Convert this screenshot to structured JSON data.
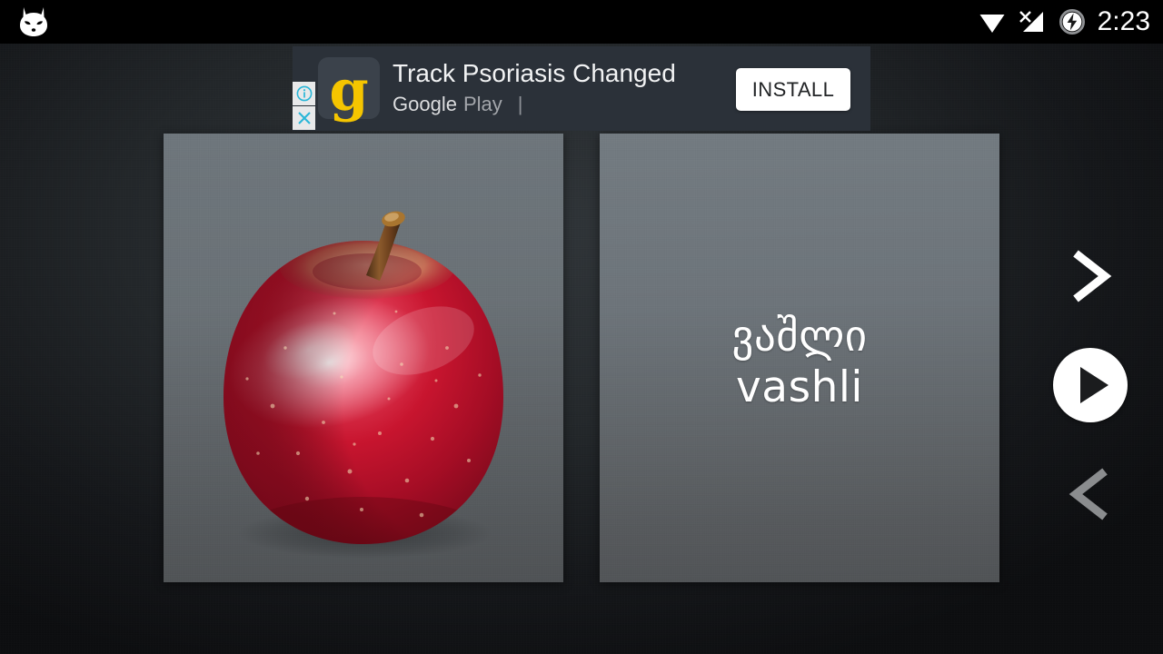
{
  "statusbar": {
    "time": "2:23",
    "icons": [
      {
        "name": "wifi-icon",
        "label": "wifi-full"
      },
      {
        "name": "cellular-no-sim-icon",
        "label": "signal-x"
      },
      {
        "name": "battery-charging-icon",
        "label": "charging"
      }
    ],
    "logo": "cyanogenmod-cid-logo"
  },
  "ad": {
    "title": "Track Psoriasis Changed",
    "store": "Google",
    "store_secondary": "Play",
    "separator": "|",
    "install_label": "INSTALL",
    "app_icon_letter": "g",
    "info_icon": "info-icon",
    "close_icon": "close-icon",
    "bg_color": "#2b3139",
    "accent_color": "#29b6d8",
    "icon_color": "#f5c500"
  },
  "flashcard": {
    "image_card": {
      "alt": "red-apple-photo",
      "name": "apple"
    },
    "word_card": {
      "native": "ვაშლი",
      "latin": "vashli"
    }
  },
  "controls": {
    "next_label": "›",
    "prev_label": "‹",
    "play_label": "play",
    "next_state": "enabled",
    "prev_state": "disabled",
    "next_color": "#ffffff",
    "prev_color": "#8b8d8f",
    "play_color": "#ffffff"
  }
}
